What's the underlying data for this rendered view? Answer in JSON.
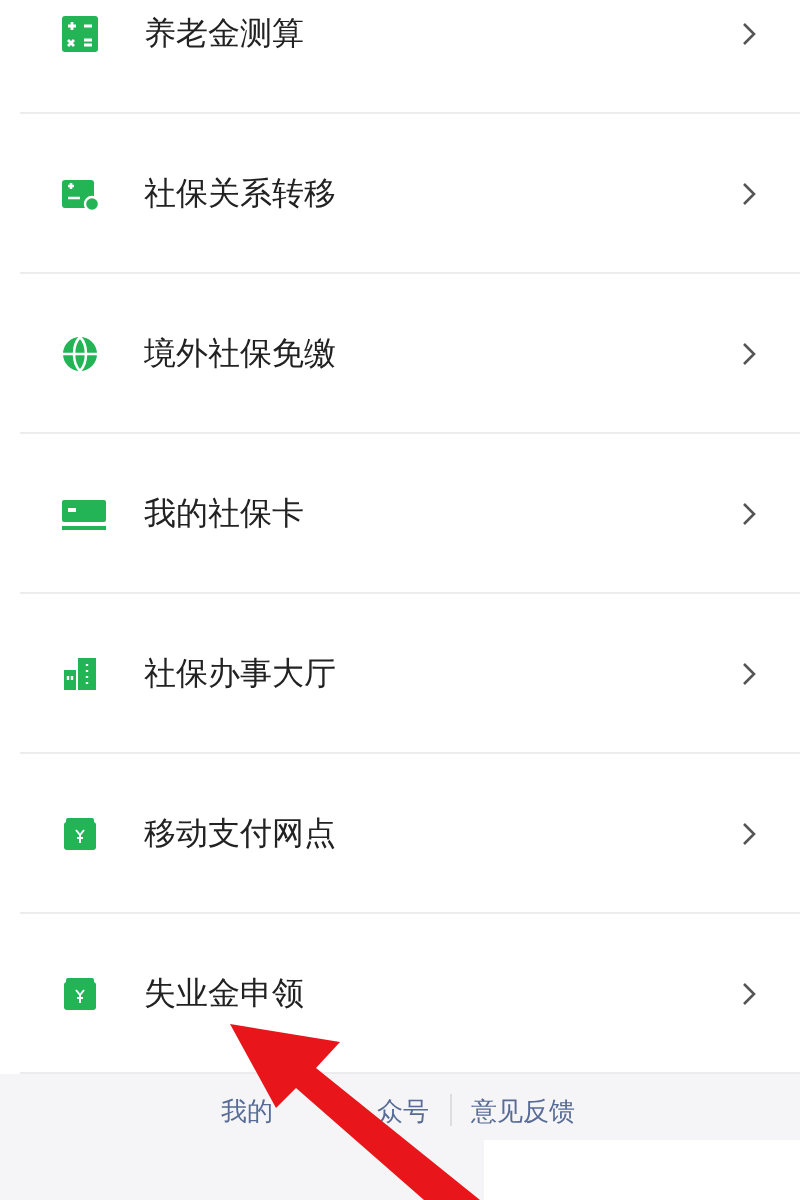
{
  "menu": [
    {
      "label": "养老金测算"
    },
    {
      "label": "社保关系转移"
    },
    {
      "label": "境外社保免缴"
    },
    {
      "label": "我的社保卡"
    },
    {
      "label": "社保办事大厅"
    },
    {
      "label": "移动支付网点"
    },
    {
      "label": "失业金申领"
    }
  ],
  "footer": {
    "link_fragments": [
      "我的",
      "众号"
    ],
    "feedback": "意见反馈"
  }
}
